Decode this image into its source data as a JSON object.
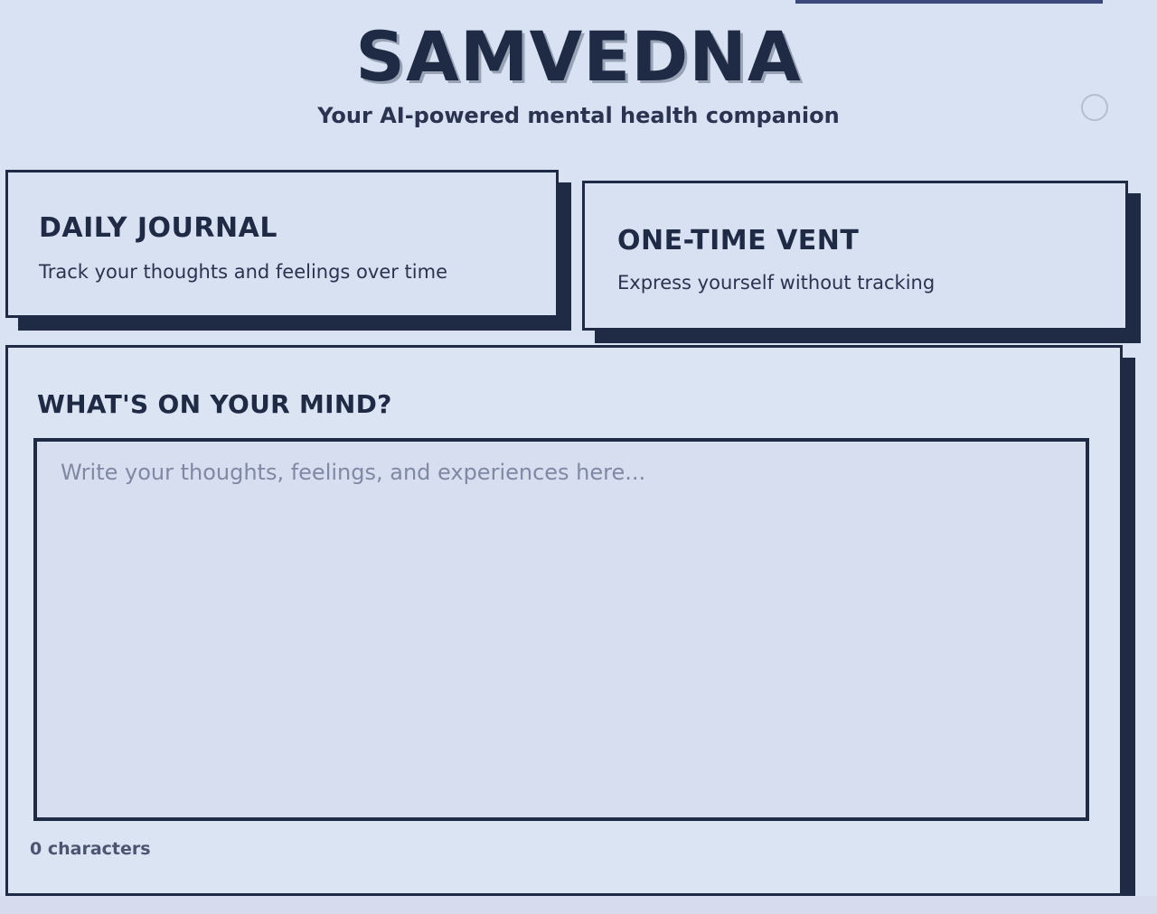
{
  "header": {
    "title": "SAMVEDNA",
    "tagline": "Your AI-powered mental health companion"
  },
  "modes": {
    "daily": {
      "title": "DAILY JOURNAL",
      "description": "Track your thoughts and feelings over time"
    },
    "vent": {
      "title": "ONE-TIME VENT",
      "description": "Express yourself without tracking"
    }
  },
  "entry": {
    "heading": "WHAT'S ON YOUR MIND?",
    "placeholder": "Write your thoughts, feelings, and experiences here...",
    "value": "",
    "char_count": "0 characters"
  },
  "colors": {
    "background": "#d9e2f2",
    "primary": "#1f2a44"
  }
}
